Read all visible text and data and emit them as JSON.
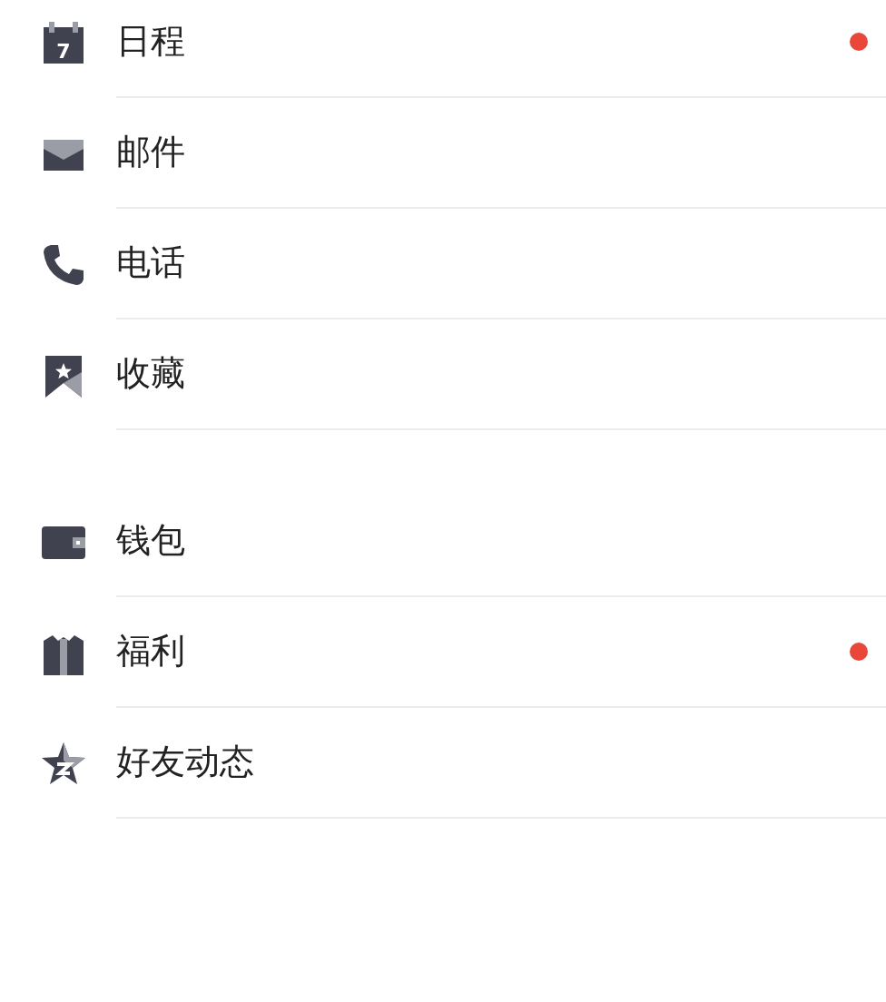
{
  "groups": [
    {
      "items": [
        {
          "label": "日程",
          "kind": "calendar",
          "icon_text": "7",
          "unread": true
        },
        {
          "label": "邮件",
          "kind": "mail",
          "unread": false
        },
        {
          "label": "电话",
          "kind": "phone",
          "unread": false
        },
        {
          "label": "收藏",
          "kind": "bookmark",
          "unread": false
        }
      ]
    },
    {
      "items": [
        {
          "label": "钱包",
          "kind": "wallet",
          "unread": false
        },
        {
          "label": "福利",
          "kind": "gift",
          "unread": true
        },
        {
          "label": "好友动态",
          "kind": "star",
          "unread": false
        }
      ]
    }
  ]
}
